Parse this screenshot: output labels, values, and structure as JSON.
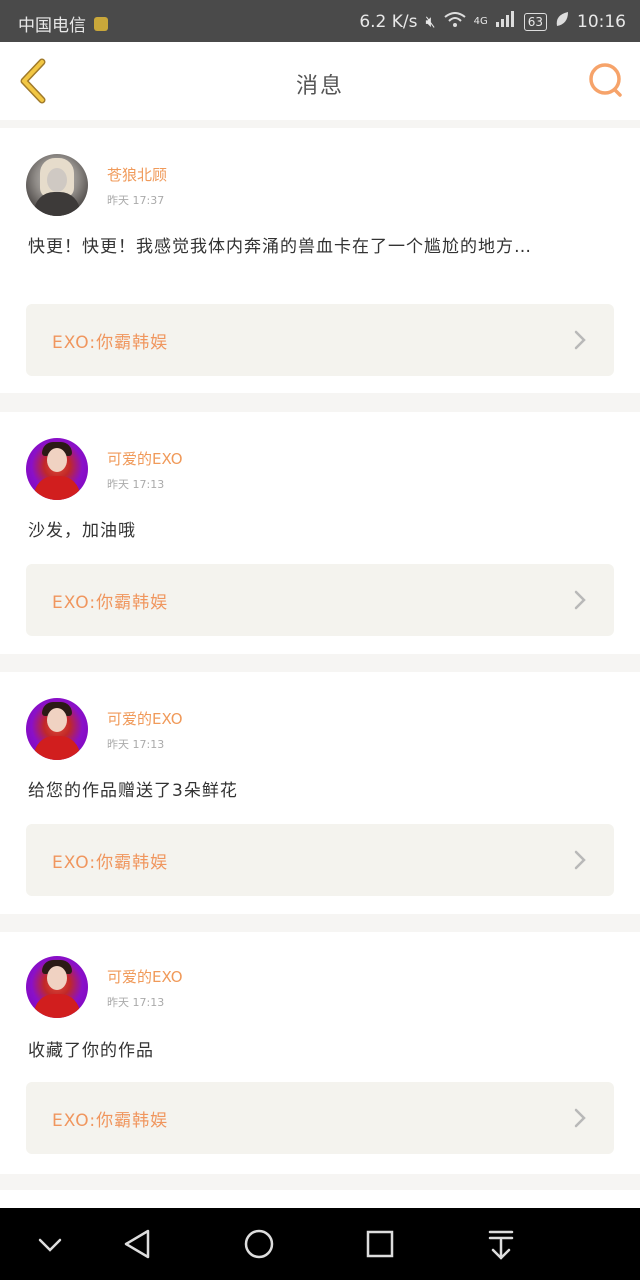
{
  "status_bar": {
    "carrier": "中国电信",
    "net_speed": "6.2 K/s",
    "network_type": "4G",
    "battery": "63",
    "time": "10:16"
  },
  "header": {
    "title": "消息",
    "back_icon": "chevron-left-icon",
    "search_icon": "search-icon",
    "accent_color": "#f09a5a"
  },
  "messages": [
    {
      "username": "苍狼北顾",
      "time": "昨天 17:37",
      "text": "快更！快更！我感觉我体内奔涌的兽血卡在了一个尴尬的地方…",
      "work_title": "EXO:你霸韩娱"
    },
    {
      "username": "可爱的EXO",
      "time": "昨天 17:13",
      "text": "沙发，加油哦",
      "work_title": "EXO:你霸韩娱"
    },
    {
      "username": "可爱的EXO",
      "time": "昨天 17:13",
      "text": "给您的作品赠送了3朵鲜花",
      "work_title": "EXO:你霸韩娱"
    },
    {
      "username": "可爱的EXO",
      "time": "昨天 17:13",
      "text": "收藏了你的作品",
      "work_title": "EXO:你霸韩娱"
    }
  ],
  "nav_bar": {
    "icons": [
      "chevron-down-icon",
      "back-triangle-icon",
      "home-circle-icon",
      "recents-square-icon",
      "download-icon"
    ]
  }
}
